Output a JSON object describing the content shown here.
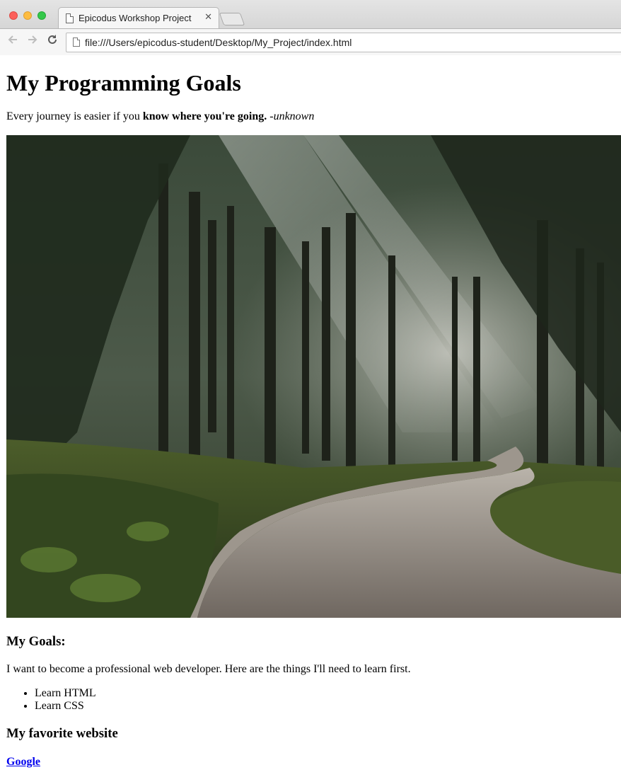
{
  "browser": {
    "tab_title": "Epicodus Workshop Project",
    "tab_close": "✕",
    "url": "file:///Users/epicodus-student/Desktop/My_Project/index.html",
    "back_icon": "arrow-left-icon",
    "forward_icon": "arrow-right-icon",
    "reload_icon": "reload-icon"
  },
  "page": {
    "title": "My Programming Goals",
    "quote": {
      "text": "Every journey is easier if you ",
      "bold": "know where you're going.",
      "author": " -unknown"
    },
    "image_alt": "Gravel road winding through a misty forest",
    "goals": {
      "heading": "My Goals:",
      "intro": "I want to become a professional web developer. Here are the things I'll need to learn first.",
      "items": [
        "Learn HTML",
        "Learn CSS"
      ]
    },
    "favorite": {
      "heading": "My favorite website",
      "link_text": "Google"
    }
  }
}
